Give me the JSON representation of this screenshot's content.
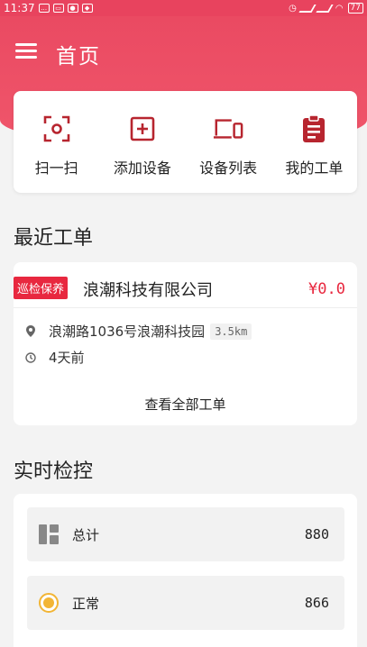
{
  "status_bar": {
    "time": "11:37",
    "battery": "77"
  },
  "header": {
    "title": "首页"
  },
  "quick_actions": [
    {
      "label": "扫一扫",
      "icon": "scan-icon"
    },
    {
      "label": "添加设备",
      "icon": "add-device-icon"
    },
    {
      "label": "设备列表",
      "icon": "device-list-icon"
    },
    {
      "label": "我的工单",
      "icon": "clipboard-icon"
    }
  ],
  "recent_orders": {
    "title": "最近工单",
    "order": {
      "tag": "巡检保养",
      "company": "浪潮科技有限公司",
      "price": "¥0.0",
      "address": "浪潮路1036号浪潮科技园",
      "distance": "3.5km",
      "time": "4天前"
    },
    "view_all": "查看全部工单"
  },
  "monitor": {
    "title": "实时检控",
    "rows": [
      {
        "label": "总计",
        "value": "880",
        "icon": "grid-icon"
      },
      {
        "label": "正常",
        "value": "866",
        "icon": "normal-status-icon"
      }
    ]
  },
  "colors": {
    "accent": "#ea4a62",
    "tag": "#e8283f",
    "icon_dark": "#b7252f",
    "normal_status": "#f2b535"
  }
}
